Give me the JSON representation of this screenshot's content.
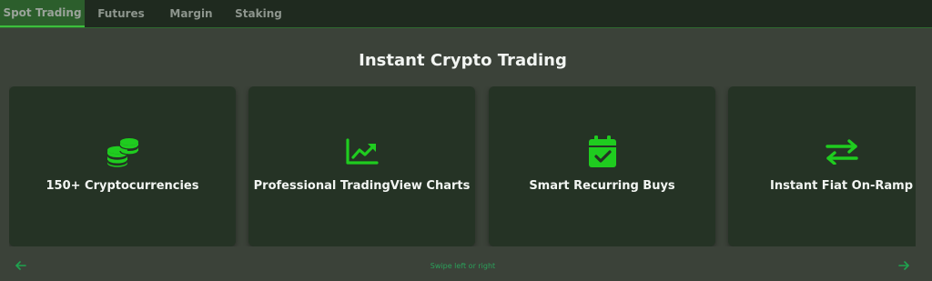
{
  "tabs": [
    {
      "label": "Spot Trading",
      "active": true
    },
    {
      "label": "Futures",
      "active": false
    },
    {
      "label": "Margin",
      "active": false
    },
    {
      "label": "Staking",
      "active": false
    }
  ],
  "title": "Instant Crypto Trading",
  "cards": [
    {
      "label": "150+ Cryptocurrencies",
      "icon": "coins-icon"
    },
    {
      "label": "Professional TradingView Charts",
      "icon": "chart-line-icon"
    },
    {
      "label": "Smart Recurring Buys",
      "icon": "calendar-check-icon"
    },
    {
      "label": "Instant Fiat On-Ramp",
      "icon": "exchange-arrows-icon"
    }
  ],
  "carousel": {
    "hint": "Swipe left or right",
    "prev_icon": "arrow-left-icon",
    "next_icon": "arrow-right-icon"
  },
  "colors": {
    "accent": "#1fcc1f",
    "background": "#3b4239",
    "card": "#253325",
    "tabbar": "#1f2a1f",
    "active_tab": "#2c5e2c"
  }
}
